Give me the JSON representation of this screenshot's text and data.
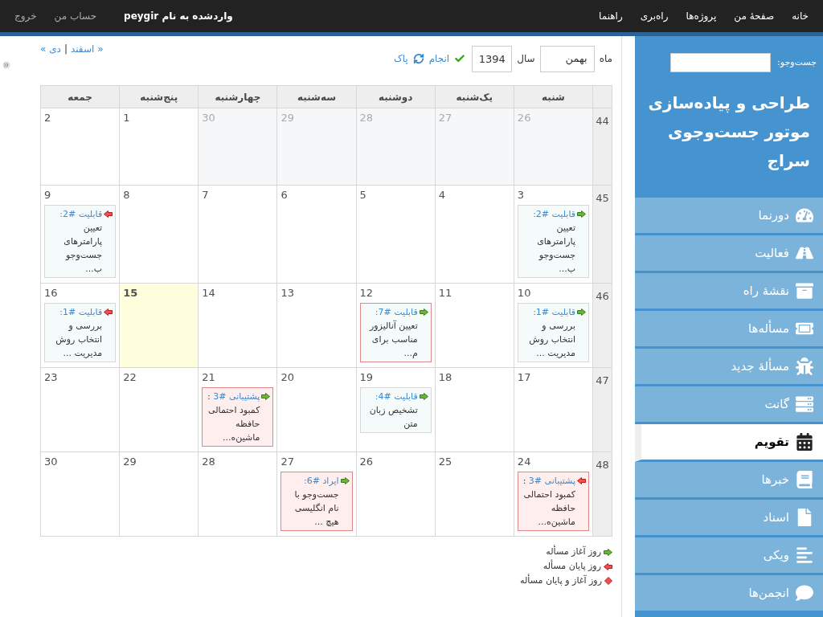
{
  "top_menu": {
    "items": [
      "خانه",
      "صفحهٔ من",
      "پروژه‌ها",
      "راه‌بری",
      "راهنما"
    ],
    "logged_in": "واردشده به نام peygir",
    "account_links": [
      "حساب من",
      "خروج"
    ]
  },
  "sidebar": {
    "search_label": "جست‌وجو:",
    "project_title": "طراحی و پیاده‌سازی موتور جست‌وجوی سراج",
    "menu": [
      {
        "label": "دورنما",
        "selected": false
      },
      {
        "label": "فعالیت",
        "selected": false
      },
      {
        "label": "نقشهٔ راه",
        "selected": false
      },
      {
        "label": "مسأله‌ها",
        "selected": false
      },
      {
        "label": "مسألهٔ جدید",
        "selected": false
      },
      {
        "label": "گانت",
        "selected": false
      },
      {
        "label": "تقویم",
        "selected": true
      },
      {
        "label": "خبرها",
        "selected": false
      },
      {
        "label": "اسناد",
        "selected": false
      },
      {
        "label": "ویکی",
        "selected": false
      },
      {
        "label": "انجمن‌ها",
        "selected": false
      }
    ]
  },
  "filters": {
    "month_label": "ماه",
    "month": "بهمن",
    "year_label": "سال",
    "year": "1394",
    "apply": "انجام",
    "clear": "پاک"
  },
  "nav": {
    "previous": "« دی",
    "separator": "|",
    "next": "اسفند »"
  },
  "calendar": {
    "weekdays": [
      "شنبه",
      "یک‌شنبه",
      "دوشنبه",
      "سه‌شنبه",
      "چهارشنبه",
      "پنج‌شنبه",
      "جمعه"
    ],
    "weeks": [
      {
        "number": "44",
        "days": [
          {
            "day": "26",
            "other_month": true,
            "today": false
          },
          {
            "day": "27",
            "other_month": true,
            "today": false
          },
          {
            "day": "28",
            "other_month": true,
            "today": false
          },
          {
            "day": "29",
            "other_month": true,
            "today": false
          },
          {
            "day": "30",
            "other_month": true,
            "today": false
          },
          {
            "day": "1",
            "other_month": false,
            "today": false
          },
          {
            "day": "2",
            "other_month": false,
            "today": false
          }
        ]
      },
      {
        "number": "45",
        "days": [
          {
            "day": "3",
            "other_month": false,
            "today": false,
            "events": [
              {
                "kind": "start",
                "overdue": false,
                "color": "#d7d7d7",
                "link": "قابلیت #2:",
                "subject": "تعیین پارامترهای جست‌وجو ب..."
              }
            ]
          },
          {
            "day": "4",
            "other_month": false,
            "today": false
          },
          {
            "day": "5",
            "other_month": false,
            "today": false
          },
          {
            "day": "6",
            "other_month": false,
            "today": false
          },
          {
            "day": "7",
            "other_month": false,
            "today": false
          },
          {
            "day": "8",
            "other_month": false,
            "today": false
          },
          {
            "day": "9",
            "other_month": false,
            "today": false,
            "events": [
              {
                "kind": "end",
                "overdue": false,
                "color": "#d7d7d7",
                "link": "قابلیت #2:",
                "subject": "تعیین پارامترهای جست‌وجو ب..."
              }
            ]
          }
        ]
      },
      {
        "number": "46",
        "days": [
          {
            "day": "10",
            "other_month": false,
            "today": false,
            "events": [
              {
                "kind": "start",
                "overdue": false,
                "color": "#d7d7d7",
                "link": "قابلیت #1:",
                "subject": "بررسی و انتخاب روش مدیریت ..."
              }
            ]
          },
          {
            "day": "11",
            "other_month": false,
            "today": false
          },
          {
            "day": "12",
            "other_month": false,
            "today": false,
            "events": [
              {
                "kind": "start",
                "overdue": false,
                "color": "#dd8888",
                "link": "قابلیت #7:",
                "subject": "تعیین آنالیزور مناسب برای م..."
              }
            ]
          },
          {
            "day": "13",
            "other_month": false,
            "today": false
          },
          {
            "day": "14",
            "other_month": false,
            "today": false
          },
          {
            "day": "15",
            "other_month": false,
            "today": true
          },
          {
            "day": "16",
            "other_month": false,
            "today": false,
            "events": [
              {
                "kind": "end",
                "overdue": false,
                "color": "#d7d7d7",
                "link": "قابلیت #1:",
                "subject": "بررسی و انتخاب روش مدیریت ..."
              }
            ]
          }
        ]
      },
      {
        "number": "47",
        "days": [
          {
            "day": "17",
            "other_month": false,
            "today": false
          },
          {
            "day": "18",
            "other_month": false,
            "today": false
          },
          {
            "day": "19",
            "other_month": false,
            "today": false,
            "events": [
              {
                "kind": "start",
                "overdue": false,
                "color": "#d7d7d7",
                "link": "قابلیت #4:",
                "subject": "تشخیص زبان متن"
              }
            ]
          },
          {
            "day": "20",
            "other_month": false,
            "today": false
          },
          {
            "day": "21",
            "other_month": false,
            "today": false,
            "events": [
              {
                "kind": "start",
                "overdue": true,
                "color": "#dd8888",
                "link": "پشتیبانی #3",
                "subject": ": کمبود احتمالی حافظه ماشین‌ه..."
              }
            ]
          },
          {
            "day": "22",
            "other_month": false,
            "today": false
          },
          {
            "day": "23",
            "other_month": false,
            "today": false
          }
        ]
      },
      {
        "number": "48",
        "days": [
          {
            "day": "24",
            "other_month": false,
            "today": false,
            "events": [
              {
                "kind": "end",
                "overdue": true,
                "color": "#dd8888",
                "link": "پشتیبانی #3",
                "subject": ": کمبود احتمالی حافظه ماشین‌ه..."
              }
            ]
          },
          {
            "day": "25",
            "other_month": false,
            "today": false
          },
          {
            "day": "26",
            "other_month": false,
            "today": false
          },
          {
            "day": "27",
            "other_month": false,
            "today": false,
            "events": [
              {
                "kind": "start",
                "overdue": true,
                "color": "#dd8888",
                "link": "ایراد #6:",
                "subject": "جست‌وجو با نام انگلیسی هیچ ..."
              }
            ]
          },
          {
            "day": "28",
            "other_month": false,
            "today": false
          },
          {
            "day": "29",
            "other_month": false,
            "today": false
          },
          {
            "day": "30",
            "other_month": false,
            "today": false
          }
        ]
      }
    ]
  },
  "legend": [
    {
      "kind": "start",
      "label": "روز آغاز مسأله"
    },
    {
      "kind": "end",
      "label": "روز پایان مسأله"
    },
    {
      "kind": "both",
      "label": "روز آغاز و پایان مسأله"
    }
  ]
}
